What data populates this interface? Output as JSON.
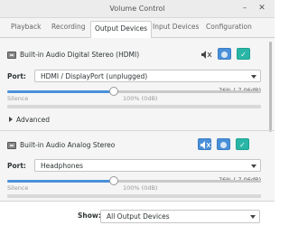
{
  "window": {
    "title": "Volume Control"
  },
  "tabs": [
    {
      "label": "Playback",
      "active": false
    },
    {
      "label": "Recording",
      "active": false
    },
    {
      "label": "Output Devices",
      "active": true
    },
    {
      "label": "Input Devices",
      "active": false
    },
    {
      "label": "Configuration",
      "active": false
    }
  ],
  "devices": [
    {
      "name": "Built-in Audio Digital Stereo (HDMI)",
      "port_label": "Port:",
      "port_value": "HDMI / DisplayPort (unplugged)",
      "volume_text": "76% (-7.06dB)",
      "volume_fraction": 0.42,
      "scale_silence": "Silence",
      "scale_100": "100% (0dB)",
      "advanced_label": "Advanced",
      "mute_active": false
    },
    {
      "name": "Built-in Audio Analog Stereo",
      "port_label": "Port:",
      "port_value": "Headphones",
      "volume_text": "76% (-7.06dB)",
      "volume_fraction": 0.42,
      "scale_silence": "Silence",
      "scale_100": "100% (0dB)",
      "mute_active": true
    }
  ],
  "footer": {
    "show_label": "Show:",
    "show_value": "All Output Devices"
  },
  "colors": {
    "accent": "#4a90d9",
    "check": "#29b6a6"
  },
  "icons": [
    "audio-card-icon",
    "mute-icon",
    "lock-channels-icon",
    "default-check-icon",
    "minimize-icon",
    "close-icon"
  ]
}
